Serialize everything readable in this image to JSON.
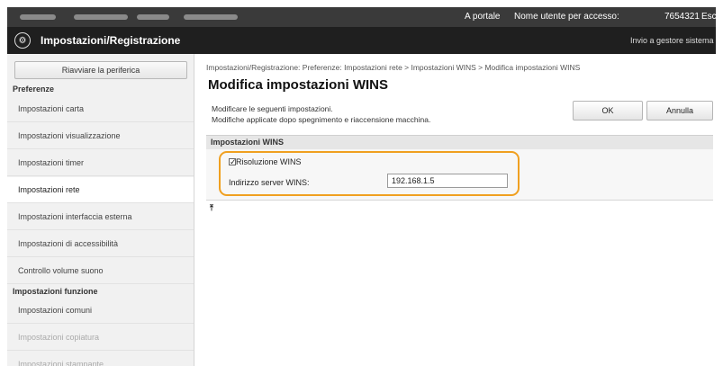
{
  "topbar": {
    "portal_link": "A portale",
    "user_label": "Nome utente per accesso:",
    "user_id": "7654321",
    "logout_link": "Esc"
  },
  "header": {
    "title": "Impostazioni/Registrazione",
    "send_link": "Invio a gestore sistema"
  },
  "sidebar": {
    "restart_button": "Riavviare la periferica",
    "sections": [
      {
        "label": "Preferenze"
      },
      {
        "label": "Impostazioni funzione"
      }
    ],
    "items": [
      {
        "label": "Impostazioni carta"
      },
      {
        "label": "Impostazioni visualizzazione"
      },
      {
        "label": "Impostazioni timer"
      },
      {
        "label": "Impostazioni rete"
      },
      {
        "label": "Impostazioni interfaccia esterna"
      },
      {
        "label": "Impostazioni di accessibilità"
      },
      {
        "label": "Controllo volume suono"
      },
      {
        "label": "Impostazioni comuni"
      },
      {
        "label": "Impostazioni copiatura"
      },
      {
        "label": "Impostazioni stampante"
      }
    ]
  },
  "main": {
    "breadcrumb": "Impostazioni/Registrazione: Preferenze: Impostazioni rete > Impostazioni WINS > Modifica impostazioni WINS",
    "title": "Modifica impostazioni WINS",
    "instruction_1": "Modificare le seguenti impostazioni.",
    "instruction_2": "Modifiche applicate dopo spegnimento e riaccensione macchina.",
    "ok_button": "OK",
    "cancel_button": "Annulla",
    "section_title": "Impostazioni WINS",
    "wins_resolution": {
      "label": "Risoluzione WINS",
      "checked": true
    },
    "wins_server": {
      "label": "Indirizzo server WINS:",
      "value": "192.168.1.5"
    },
    "highlight_color": "#f0a020"
  }
}
